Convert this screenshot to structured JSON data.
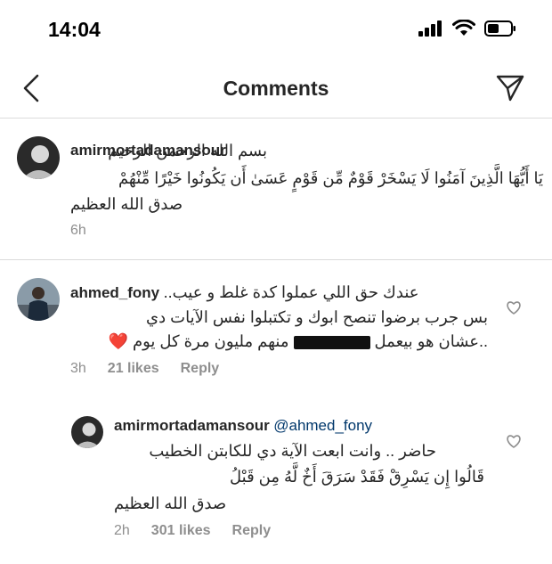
{
  "status": {
    "time": "14:04"
  },
  "nav": {
    "title": "Comments"
  },
  "caption": {
    "username": "amirmortadamansour",
    "line1": "بسم الله الرحمن الرحيم",
    "line2": "يَا أَيُّهَا الَّذِينَ آمَنُوا لَا يَسْخَرْ قَوْمٌ مِّن قَوْمٍ عَسَىٰ أَن يَكُونُوا خَيْرًا مِّنْهُمْ",
    "line3": "صدق الله العظيم",
    "time": "6h"
  },
  "comment": {
    "username": "ahmed_fony",
    "line1_tail": "عندك حق اللي عملوا كدة غلط و عيب..",
    "line2": "بس جرب برضوا تنصح ابوك و تكتبلوا نفس الآيات دي",
    "line3_part1": "..عشان هو بيعمل",
    "line3_part2": "منهم مليون مرة كل يوم",
    "emoji": "❤️",
    "time": "3h",
    "likes": "21 likes",
    "reply": "Reply"
  },
  "reply": {
    "username": "amirmortadamansour",
    "mention": "@ahmed_fony",
    "line1": "حاضر .. وانت ابعت الآية دي للكابتن الخطيب",
    "line2": "قَالُوا إِن يَسْرِقْ فَقَدْ سَرَقَ أَخٌ لَّهُ مِن قَبْلُ",
    "line3": "صدق الله العظيم",
    "time": "2h",
    "likes": "301 likes",
    "reply": "Reply"
  },
  "icons": {
    "back": "chevron-left-icon",
    "share": "paper-plane-icon",
    "like": "heart-icon"
  }
}
